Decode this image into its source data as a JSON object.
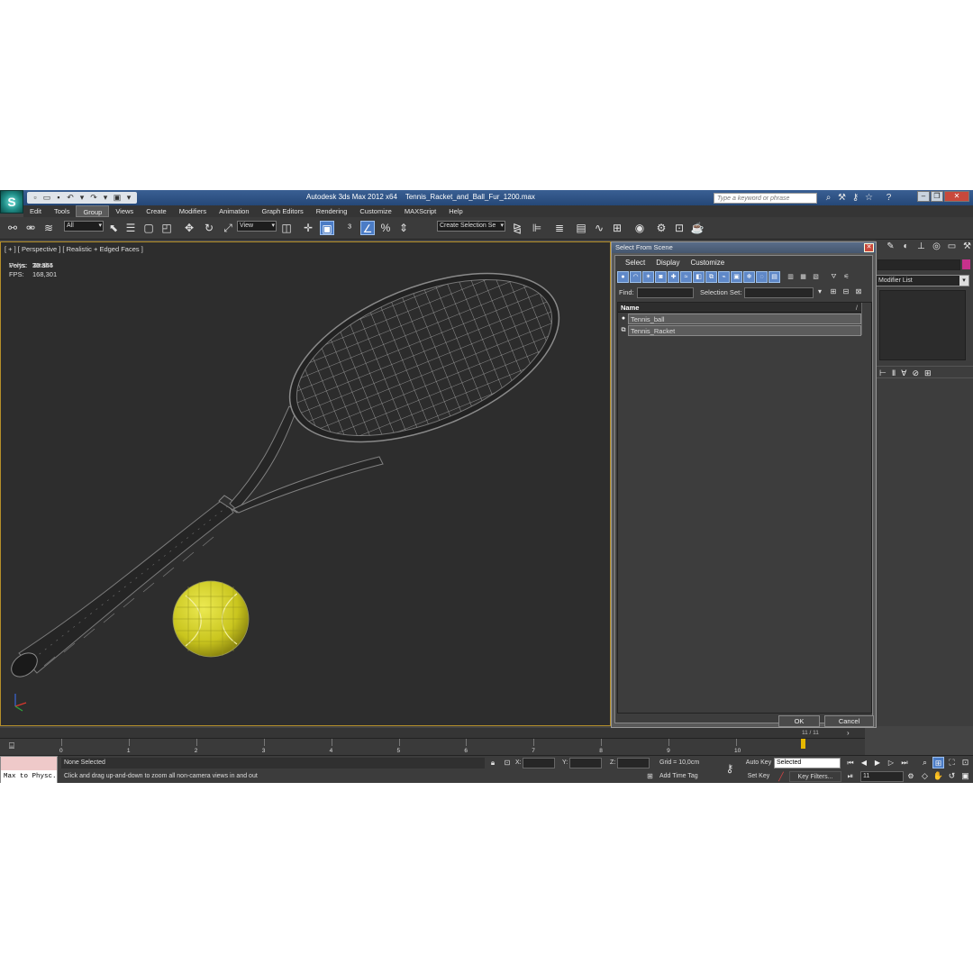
{
  "window": {
    "app_title": "Autodesk 3ds Max  2012 x64",
    "file_name": "Tennis_Racket_and_Ball_Fur_1200.max",
    "search_placeholder": "Type a keyword or phrase"
  },
  "menu": [
    "Edit",
    "Tools",
    "Group",
    "Views",
    "Create",
    "Modifiers",
    "Animation",
    "Graph Editors",
    "Rendering",
    "Customize",
    "MAXScript",
    "Help"
  ],
  "menu_active": "Group",
  "toolbar": {
    "selection_filter": "All",
    "ref_coord": "View",
    "selection_set": "Create Selection Se"
  },
  "viewport": {
    "label": "[ + ] [ Perspective ] [ Realistic + Edged Faces ]",
    "stats_header": "Total",
    "stats": [
      {
        "key": "Polys:",
        "value": "32 345"
      },
      {
        "key": "Verts:",
        "value": "29 354"
      }
    ],
    "fps_label": "FPS:",
    "fps_value": "168,301",
    "ball_color": "#d8d42a",
    "wire_color": "#8a8a8a"
  },
  "command_panel": {
    "modifier_list": "Modifier List",
    "object_color": "#c7318c"
  },
  "dialog": {
    "title": "Select From Scene",
    "menu": [
      "Select",
      "Display",
      "Customize"
    ],
    "find_label": "Find:",
    "selection_set_label": "Selection Set:",
    "column_name": "Name",
    "column_sort": "/",
    "items": [
      {
        "icon": "sphere-icon",
        "name": "Tennis_ball"
      },
      {
        "icon": "object-icon",
        "name": "Tennis_Racket"
      }
    ],
    "ok_label": "OK",
    "cancel_label": "Cancel"
  },
  "timeline": {
    "slider_label": "11 / 11",
    "ticks": [
      "0",
      "1",
      "2",
      "3",
      "4",
      "5",
      "6",
      "7",
      "8",
      "9",
      "10"
    ],
    "current_frame": 11,
    "total_frames": 11
  },
  "status": {
    "maxscript_output": "Max to Physc.",
    "selection": "None Selected",
    "prompt": "Click and drag up-and-down to zoom all non-camera views in and out",
    "x_label": "X:",
    "y_label": "Y:",
    "z_label": "Z:",
    "grid": "Grid = 10,0cm",
    "add_time_tag": "Add Time Tag",
    "auto_key": "Auto Key",
    "set_key": "Set Key",
    "selected_combo": "Selected",
    "key_filters": "Key Filters...",
    "frame": "11"
  }
}
